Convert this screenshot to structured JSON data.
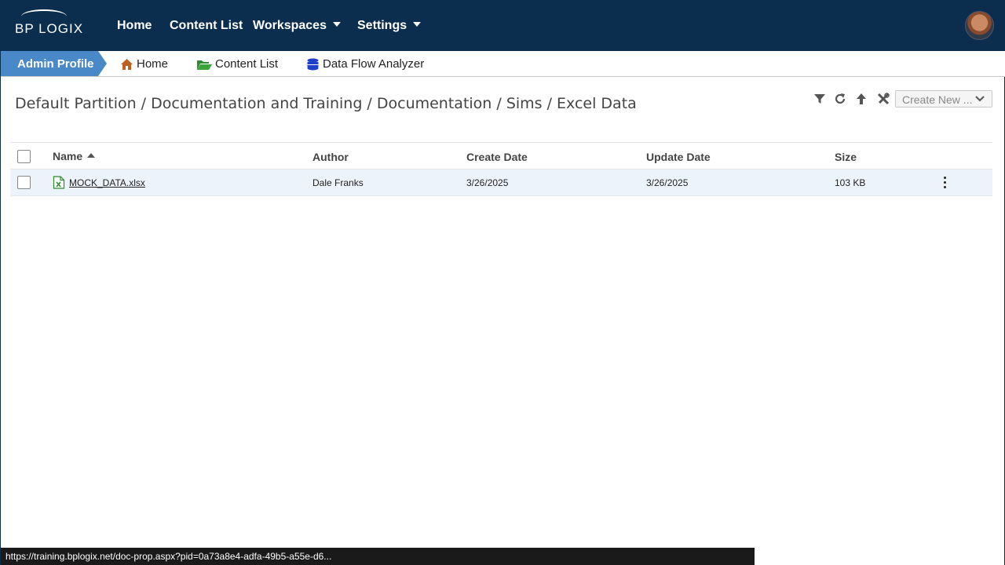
{
  "header": {
    "logo": "BP LOGIX",
    "nav": [
      {
        "label": "Home"
      },
      {
        "label": "Content List"
      },
      {
        "label": "Workspaces"
      },
      {
        "label": "Settings"
      }
    ]
  },
  "subnav": {
    "active": "Admin Profile",
    "items": [
      {
        "label": "Home",
        "icon": "home-icon"
      },
      {
        "label": "Content List",
        "icon": "folder-open-icon"
      },
      {
        "label": "Data Flow Analyzer",
        "icon": "database-icon"
      }
    ]
  },
  "breadcrumb": "Default Partition / Documentation and Training / Documentation / Sims / Excel Data",
  "toolbar": {
    "create_new": "Create New ...",
    "icons": [
      "filter-icon",
      "refresh-icon",
      "up-arrow-icon",
      "tools-icon"
    ]
  },
  "table": {
    "columns": [
      "Name",
      "Author",
      "Create Date",
      "Update Date",
      "Size"
    ],
    "sort_column": "Name",
    "rows": [
      {
        "name": "MOCK_DATA.xlsx",
        "author": "Dale Franks",
        "create_date": "3/26/2025",
        "update_date": "3/26/2025",
        "size": "103 KB"
      }
    ]
  },
  "status_bar": {
    "url": "https://training.bplogix.net/doc-prop.aspx?pid=0a73a8e4-adfa-49b5-a55e-d6..."
  },
  "colors": {
    "navbar": "#0b2e4f",
    "active_tab": "#4a89c7",
    "row_highlight": "#edf3fb",
    "home_icon": "#c0601a",
    "folder_icon": "#2e8b2e",
    "database_icon": "#1e3fc9"
  }
}
